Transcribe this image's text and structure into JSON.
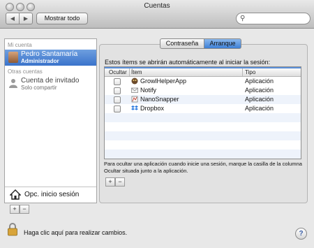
{
  "window": {
    "title": "Cuentas"
  },
  "toolbar": {
    "back_label": "◀",
    "forward_label": "▶",
    "show_all_label": "Mostrar todo",
    "search_placeholder": ""
  },
  "sidebar": {
    "my_account_header": "Mi cuenta",
    "current_user": {
      "name": "Pedro Santamaría",
      "role": "Administrador"
    },
    "other_accounts_header": "Otras cuentas",
    "guest_user": {
      "name": "Cuenta de invitado",
      "role": "Solo compartir"
    },
    "login_options_label": "Opc. inicio sesión",
    "add_label": "+",
    "remove_label": "−"
  },
  "tabs": {
    "password": "Contraseña",
    "startup": "Arranque",
    "selected": "Arranque"
  },
  "startup": {
    "intro": "Estos ítems se abrirán automáticamente al iniciar la sesión:",
    "columns": {
      "hide": "Ocultar",
      "item": "Ítem",
      "type": "Tipo"
    },
    "items": [
      {
        "name": "GrowlHelperApp",
        "type": "Aplicación",
        "icon": "growl-icon",
        "hidden": false
      },
      {
        "name": "Notify",
        "type": "Aplicación",
        "icon": "notify-mail-icon",
        "hidden": false
      },
      {
        "name": "NanoSnapper",
        "type": "Aplicación",
        "icon": "nanosnapper-icon",
        "hidden": false
      },
      {
        "name": "Dropbox",
        "type": "Aplicación",
        "icon": "dropbox-icon",
        "hidden": false
      }
    ],
    "help": "Para ocultar una aplicación cuando inicie una sesión, marque la casilla de la columna Ocultar situada junto a la aplicación.",
    "add_label": "+",
    "remove_label": "−"
  },
  "footer": {
    "lock_text": "Haga clic aquí para realizar cambios.",
    "help_label": "?"
  },
  "colors": {
    "selection": "#3a73cb",
    "accent": "#5a8fd8"
  }
}
